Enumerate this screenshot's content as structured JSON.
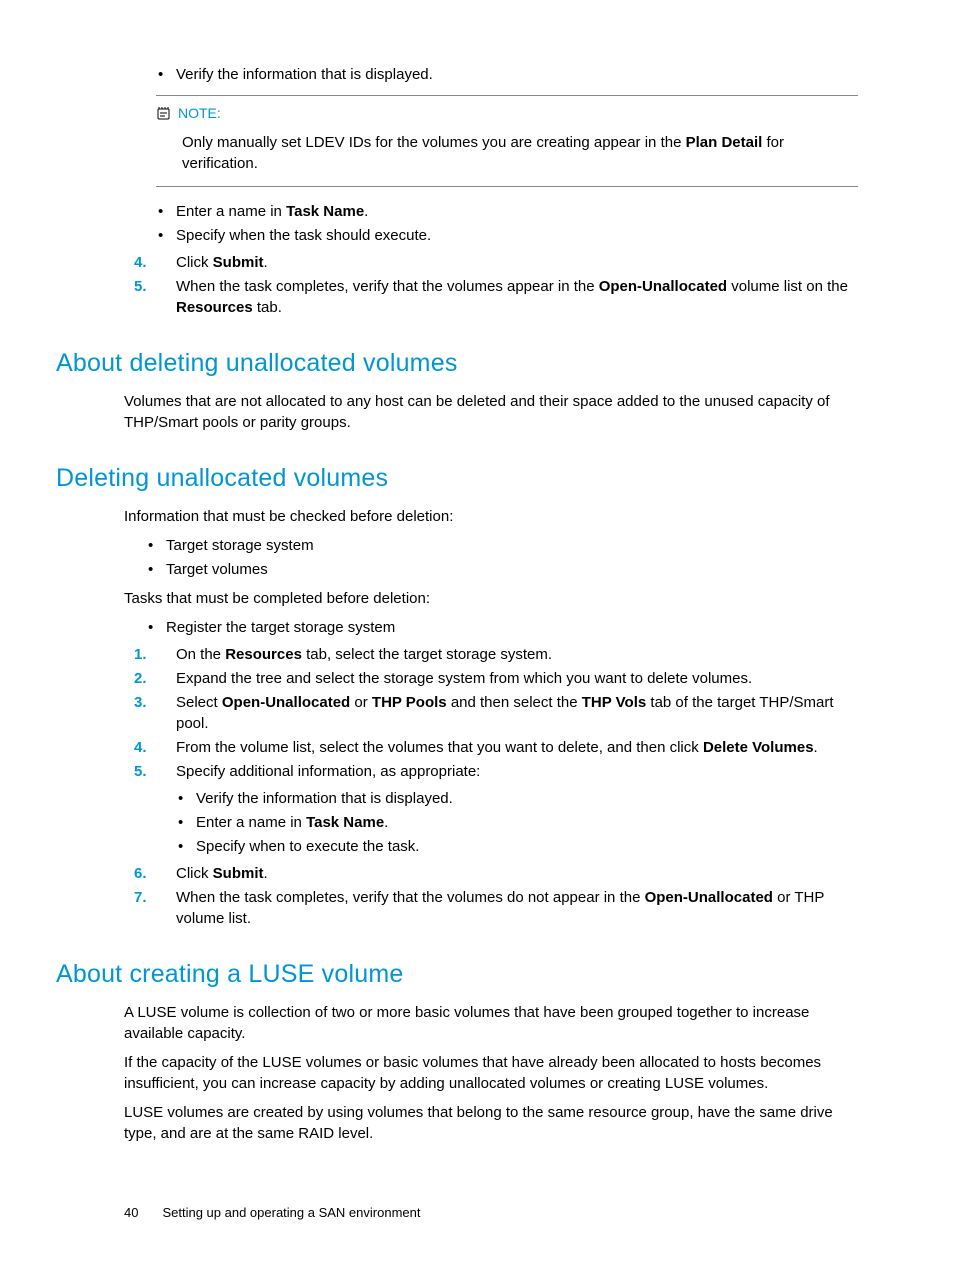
{
  "top": {
    "bullet1": "Verify the information that is displayed.",
    "note_label": "NOTE:",
    "note_body_a": "Only manually set LDEV IDs for the volumes you are creating appear in the ",
    "note_body_bold": "Plan Detail",
    "note_body_b": " for verification.",
    "bullet2a": "Enter a name in ",
    "bullet2a_bold": "Task Name",
    "bullet2a_end": ".",
    "bullet2b": "Specify when the task should execute.",
    "step4a": "Click ",
    "step4_bold": "Submit",
    "step4b": ".",
    "step5a": "When the task completes, verify that the volumes appear in the ",
    "step5_bold1": "Open-Unallocated",
    "step5b": " volume list on the ",
    "step5_bold2": "Resources",
    "step5c": " tab."
  },
  "sec1": {
    "heading": "About deleting unallocated volumes",
    "p1": "Volumes that are not allocated to any host can be deleted and their space added to the unused capacity of THP/Smart pools or parity groups."
  },
  "sec2": {
    "heading": "Deleting unallocated volumes",
    "p1": "Information that must be checked before deletion:",
    "b1": "Target storage system",
    "b2": "Target volumes",
    "p2": "Tasks that must be completed before deletion:",
    "b3": "Register the target storage system",
    "s1a": "On the ",
    "s1_bold": "Resources",
    "s1b": " tab, select the target storage system.",
    "s2": "Expand the tree and select the storage system from which you want to delete volumes.",
    "s3a": "Select ",
    "s3_bold1": "Open-Unallocated",
    "s3b": " or ",
    "s3_bold2": "THP Pools",
    "s3c": " and then select the ",
    "s3_bold3": "THP Vols",
    "s3d": " tab of the target THP/Smart pool.",
    "s4a": "From the volume list, select the volumes that you want to delete, and then click ",
    "s4_bold": "Delete Volumes",
    "s4b": ".",
    "s5": "Specify additional information, as appropriate:",
    "s5b1": "Verify the information that is displayed.",
    "s5b2a": "Enter a name in ",
    "s5b2_bold": "Task Name",
    "s5b2b": ".",
    "s5b3": "Specify when to execute the task.",
    "s6a": "Click ",
    "s6_bold": "Submit",
    "s6b": ".",
    "s7a": "When the task completes, verify that the volumes do not appear in the ",
    "s7_bold": "Open-Unallocated",
    "s7b": " or THP volume list."
  },
  "sec3": {
    "heading": "About creating a LUSE volume",
    "p1": "A LUSE volume is collection of two or more basic volumes that have been grouped together to increase available capacity.",
    "p2": "If the capacity of the LUSE volumes or basic volumes that have already been allocated to hosts becomes insufficient, you can increase capacity by adding unallocated volumes or creating LUSE volumes.",
    "p3": "LUSE volumes are created by using volumes that belong to the same resource group, have the same drive type, and are at the same RAID level."
  },
  "footer": {
    "page": "40",
    "title": "Setting up and operating a SAN environment"
  }
}
